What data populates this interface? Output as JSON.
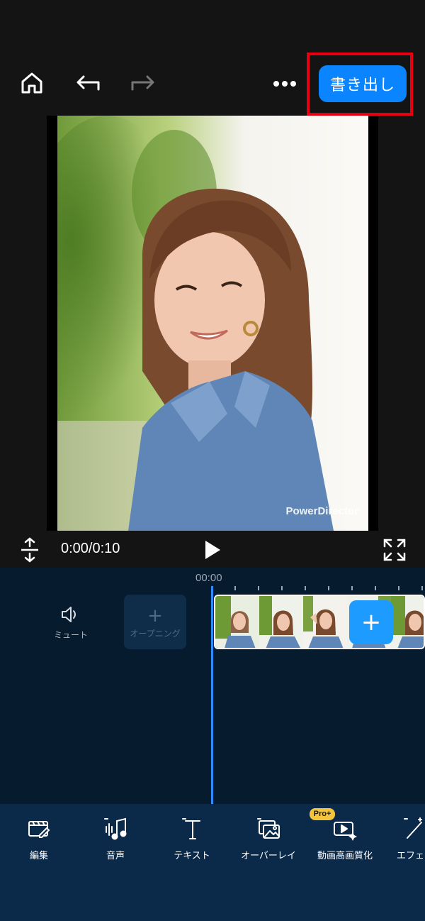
{
  "header": {
    "export_label": "書き出し"
  },
  "preview": {
    "watermark": "PowerDirector"
  },
  "playback": {
    "time": "0:00/0:10"
  },
  "timeline": {
    "ruler_time": "00:00",
    "mute_label": "ミュート",
    "opening_label": "オープニング",
    "add_clip_symbol": "+"
  },
  "toolbar": {
    "items": [
      {
        "label": "編集",
        "icon": "edit-icon"
      },
      {
        "label": "音声",
        "icon": "audio-icon"
      },
      {
        "label": "テキスト",
        "icon": "text-icon"
      },
      {
        "label": "オーバーレイ",
        "icon": "overlay-icon"
      },
      {
        "label": "動画高画質化",
        "icon": "video-enhance-icon",
        "badge": "Pro+"
      },
      {
        "label": "エフェ",
        "icon": "effect-icon"
      }
    ]
  },
  "colors": {
    "accent": "#0a84ff",
    "highlight": "#e60012",
    "timeline_bg": "#071b2e",
    "toolbar_bg": "#0b2a4a"
  }
}
